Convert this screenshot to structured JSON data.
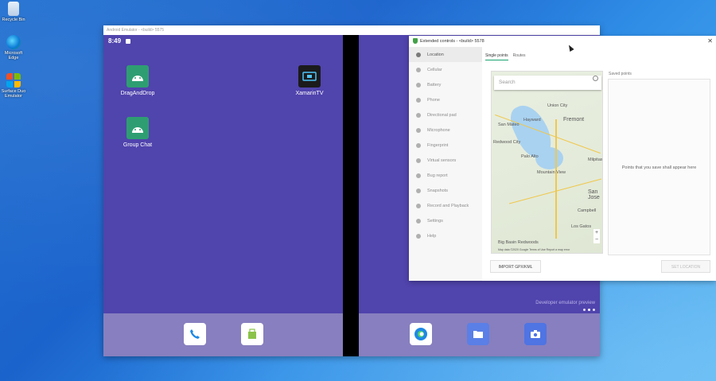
{
  "desktop": {
    "icons": [
      {
        "name": "recycle-bin",
        "label": "Recycle Bin"
      },
      {
        "name": "edge",
        "label": "Microsoft Edge"
      },
      {
        "name": "emulator",
        "label": "Surface Duo Emulator"
      }
    ]
  },
  "emulator": {
    "title": "Android Emulator - <build> 5575",
    "status_time": "8:49",
    "apps": [
      {
        "label": "DragAndDrop",
        "color": "#2e9e72"
      },
      {
        "label": "Group Chat",
        "color": "#2e9e72"
      },
      {
        "label": "XamarinTV",
        "color": "#1b1b1b"
      }
    ],
    "dev_preview": "Developer emulator preview",
    "dock_left": [
      "phone-icon",
      "store-icon"
    ],
    "dock_right": [
      "edge-icon",
      "files-icon",
      "camera-icon"
    ]
  },
  "extended_controls": {
    "title": "Extended controls - <build> 5578",
    "close": "✕",
    "sidebar": [
      "Location",
      "Cellular",
      "Battery",
      "Phone",
      "Directional pad",
      "Microphone",
      "Fingerprint",
      "Virtual sensors",
      "Bug report",
      "Snapshots",
      "Record and Playback",
      "Settings",
      "Help"
    ],
    "tabs": [
      "Single points",
      "Routes"
    ],
    "search_placeholder": "Search",
    "saved_points_label": "Saved points",
    "saved_points_empty": "Points that you save shall appear here",
    "import_button": "IMPORT GPX/KML",
    "set_location_button": "SET LOCATION",
    "map_footer": "Map data ©2020 Google   Terms of Use   Report a map error",
    "zoom_in": "+",
    "zoom_out": "−",
    "map_towns": [
      "Union City",
      "Fremont",
      "San Mateo",
      "Hayward",
      "Redwood City",
      "Palo Alto",
      "Mountain View",
      "Milpitas",
      "San Jose",
      "Campbell",
      "Los Gatos",
      "Big Basin Redwoods"
    ]
  }
}
